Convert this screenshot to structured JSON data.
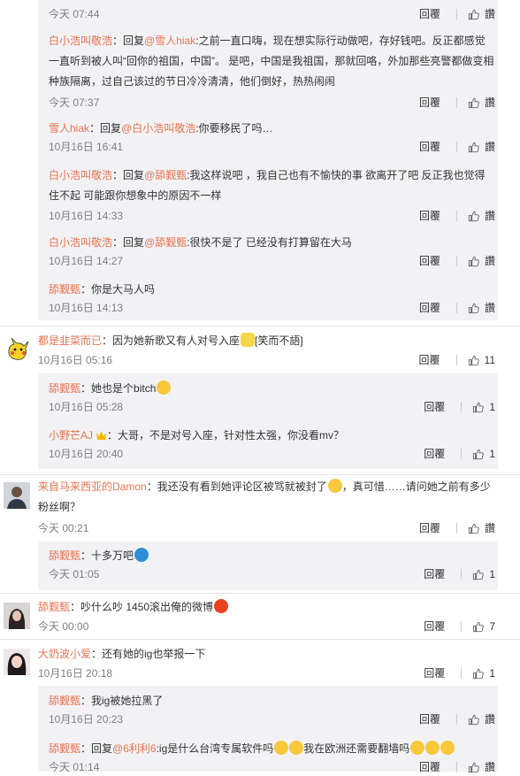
{
  "labels": {
    "reply": "回覆",
    "like": "讚"
  },
  "replies_a": [
    {
      "time": "今天 07:44"
    },
    {
      "user": "白小浩叫敬浩",
      "prefix": "：回复",
      "mention": "@雪人hiak",
      "text": ":之前一直口嗨，现在想实际行动做吧，存好钱吧。反正都感觉一直听到被人叫“回你的祖国，中国”。 是吧，中国是我祖国，那就回咯，外加那些亮警都做变相种族隔离，过自己该过的节日冷冷清清，他们倒好，热热闹闹",
      "time": "今天 07:37"
    },
    {
      "user": "雪人hiak",
      "prefix": "：回复",
      "mention": "@白小浩叫敬浩",
      "text": ":你要移民了吗…",
      "time": "10月16日 16:41"
    },
    {
      "user": "白小浩叫敬浩",
      "prefix": "：回复",
      "mention": "@舔觐甄",
      "text": ":我这样说吧 ，我自己也有不愉快的事 欲离开了吧 反正我也觉得住不起 可能跟你想象中的原因不一样",
      "time": "10月16日 14:33"
    },
    {
      "user": "白小浩叫敬浩",
      "prefix": "：回复",
      "mention": "@舔觐甄",
      "text": ":很快不是了 已经没有打算留在大马",
      "time": "10月16日 14:27"
    },
    {
      "user": "舔觐甄",
      "text": "：你是大马人吗",
      "time": "10月16日 14:13"
    }
  ],
  "comment1": {
    "user": "都是韭菜而已",
    "text": "：因为她新歌又有人对号入座",
    "tail": "[笑而不語]",
    "time": "10月16日 05:16",
    "likes": "11"
  },
  "replies_b": [
    {
      "user": "舔觐甄",
      "text": "：她也是个bitch",
      "time": "10月16日 05:28",
      "likes": "1"
    },
    {
      "user": "小野芒AJ",
      "text": "：大哥，不是对号入座，针对性太强，你没看mv？",
      "time": "10月16日 20:40",
      "likes": "1"
    }
  ],
  "comment2": {
    "user": "来自马来西亚的Damon",
    "text": "：我还没有看到她评论区被骂就被封了",
    "text2": "，真可惜……请问她之前有多少粉丝啊？",
    "time": "今天 00:21"
  },
  "reply_c": {
    "user": "舔觐甄",
    "text": "：十多万吧",
    "time": "今天 01:05",
    "likes": "1"
  },
  "comment3": {
    "user": "舔觐甄",
    "text": "：吵什么吵 1450滚出俺的微博",
    "time": "今天 00:00",
    "likes": "7"
  },
  "comment4": {
    "user": "大奶波小爱",
    "text": "：还有她的ig也举报一下",
    "time": "10月16日 20:18",
    "likes": "1"
  },
  "replies_d": [
    {
      "user": "舔觐甄",
      "text": "：我ig被她拉黑了",
      "time": "10月16日 20:23"
    },
    {
      "user": "舔觐甄",
      "prefix": "：回复",
      "mention": "@6利利6",
      "text": ":ig是什么台湾专属软件吗",
      "text2": "我在欧洲还需要翻墙吗",
      "time": "今天 01:14"
    }
  ],
  "colors": {
    "name": "#eb7350",
    "meta": "#808080",
    "panel": "#f2f2f5"
  }
}
